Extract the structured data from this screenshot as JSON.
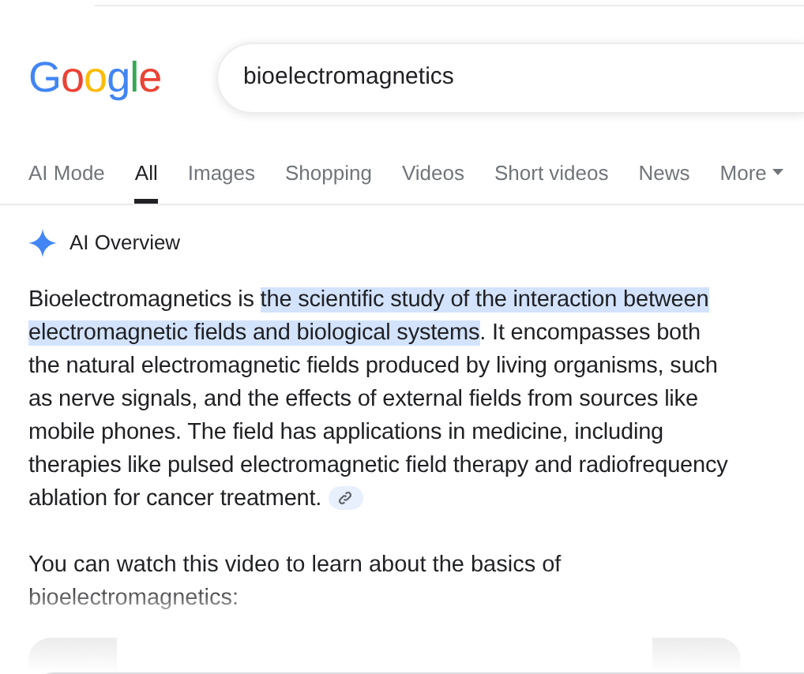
{
  "logo": {
    "letters": [
      {
        "char": "G",
        "color": "#4285f4"
      },
      {
        "char": "o",
        "color": "#ea4335"
      },
      {
        "char": "o",
        "color": "#fbbc05"
      },
      {
        "char": "g",
        "color": "#4285f4"
      },
      {
        "char": "l",
        "color": "#34a853"
      },
      {
        "char": "e",
        "color": "#ea4335"
      }
    ]
  },
  "search": {
    "value": "bioelectromagnetics"
  },
  "tabs": [
    {
      "label": "AI Mode",
      "selected": false
    },
    {
      "label": "All",
      "selected": true
    },
    {
      "label": "Images",
      "selected": false
    },
    {
      "label": "Shopping",
      "selected": false
    },
    {
      "label": "Videos",
      "selected": false
    },
    {
      "label": "Short videos",
      "selected": false
    },
    {
      "label": "News",
      "selected": false
    },
    {
      "label": "More",
      "selected": false,
      "kind": "menu"
    }
  ],
  "ai_overview": {
    "title": "AI Overview",
    "paragraph": {
      "lead": "Bioelectromagnetics is ",
      "highlighted": "the scientific study of the interaction between electromagnetic fields and biological systems",
      "rest": ". It encompasses both the natural electromagnetic fields produced by living organisms, such as nerve signals, and the effects of external fields from sources like mobile phones. The field has applications in medicine, including therapies like pulsed electromagnetic field therapy and radiofrequency ablation for cancer treatment."
    },
    "video_intro": "You can watch this video to learn about the basics of bioelectromagnetics:"
  }
}
